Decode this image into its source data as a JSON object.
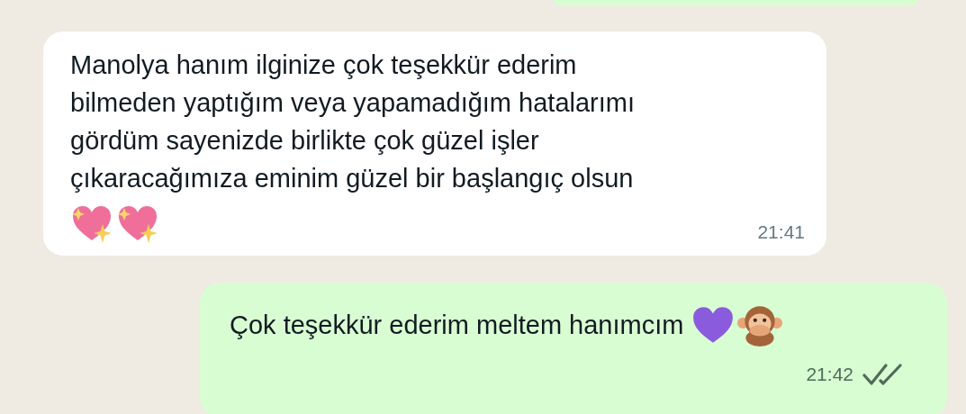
{
  "messages": [
    {
      "kind": "incoming",
      "lines": [
        "Manolya hanım ilginize çok teşekkür ederim",
        "bilmeden yaptığım veya yapamadığım hatalarımı",
        "gördüm sayenizde birlikte çok güzel işler",
        "çıkaracağımıza eminim güzel bir başlangıç olsun"
      ],
      "emojis": [
        {
          "kind": "sparkling-heart"
        },
        {
          "kind": "sparkling-heart"
        }
      ],
      "time": "21:41"
    },
    {
      "kind": "outgoing",
      "lines": [
        "Çok teşekkür ederim meltem hanımcım"
      ],
      "emojis": [
        {
          "kind": "purple-heart"
        },
        {
          "kind": "monkey"
        }
      ],
      "time": "21:42",
      "read": false
    }
  ]
}
